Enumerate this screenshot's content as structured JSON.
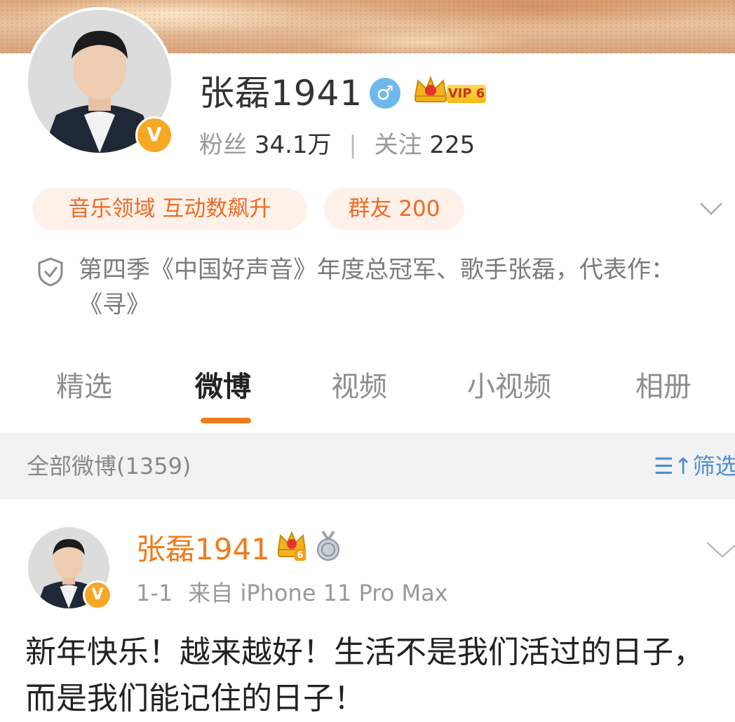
{
  "profile": {
    "name": "张磊1941",
    "gender_symbol": "♂",
    "vip_label": "VIP 6",
    "verified_mark": "V",
    "fans_label": "粉丝",
    "fans_count": "34.1万",
    "divider": "|",
    "following_label": "关注",
    "following_count": "225"
  },
  "tags": {
    "tag1": "音乐领域 互动数飙升",
    "tag2": "群友 200"
  },
  "bio": {
    "text": "第四季《中国好声音》年度总冠军、歌手张磊，代表作：《寻》"
  },
  "tabs": [
    "精选",
    "微博",
    "视频",
    "小视频",
    "相册"
  ],
  "active_tab": "微博",
  "subbar": {
    "all_posts": "全部微博(1359)",
    "filter_icon": "☰↑",
    "filter_label": "筛选"
  },
  "post": {
    "author": "张磊1941",
    "verified_mark": "V",
    "crown_level": "6",
    "date": "1-1",
    "source": "来自 iPhone 11 Pro Max",
    "text": "新年快乐！越来越好！生活不是我们活过的日子，而是我们能记住的日子！"
  },
  "icons": {
    "gender": "male-gender-icon",
    "vip": "vip-crown-icon",
    "expand": "chevron-down-icon",
    "bio": "shield-check-icon",
    "filter": "filter-icon",
    "medal": "medal-icon"
  },
  "colors": {
    "accent_orange": "#f07b1a",
    "verified_gold": "#f7a823",
    "link_blue": "#4b8fd6",
    "gender_blue": "#6fb8ec"
  }
}
